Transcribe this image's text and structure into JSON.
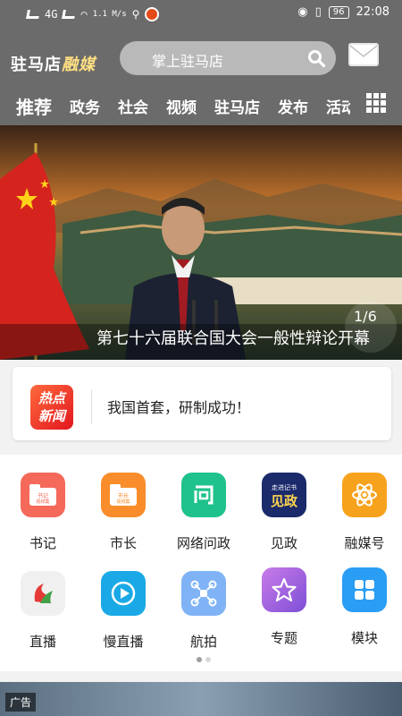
{
  "status_bar": {
    "left_net": "4G",
    "speed": "1.1 M/s",
    "battery": "96",
    "time": "22:08"
  },
  "header": {
    "logo_text": "驻马店",
    "logo_brand": "融媒",
    "search_placeholder": "掌上驻马店"
  },
  "tabs": [
    {
      "label": "推荐",
      "active": true
    },
    {
      "label": "政务"
    },
    {
      "label": "社会"
    },
    {
      "label": "视频"
    },
    {
      "label": "驻马店"
    },
    {
      "label": "发布"
    },
    {
      "label": "活动"
    }
  ],
  "banner": {
    "caption": "第七十六届联合国大会一般性辩论开幕",
    "pager": "1/6"
  },
  "hot_news": {
    "badge_line1": "热点",
    "badge_line2": "新闻",
    "headline": "我国首套，研制成功！"
  },
  "shortcuts": [
    {
      "label": "书记",
      "icon": "folder-shuji-icon",
      "color": "#f4695a"
    },
    {
      "label": "市长",
      "icon": "folder-shizhang-icon",
      "color": "#f98d2b"
    },
    {
      "label": "网络问政",
      "icon": "wen-icon",
      "color": "#1fc28c"
    },
    {
      "label": "见政",
      "icon": "jianzheng-logo-icon",
      "color": "#1b2a6b"
    },
    {
      "label": "融媒号",
      "icon": "atom-icon",
      "color": "#f7a21c"
    },
    {
      "label": "直播",
      "icon": "live-logo-icon",
      "color": "#f0f0f0"
    },
    {
      "label": "慢直播",
      "icon": "play-icon",
      "color": "#1aa9e6"
    },
    {
      "label": "航拍",
      "icon": "drone-icon",
      "color": "#7fb3f5"
    },
    {
      "label": "专题",
      "icon": "star-icon",
      "color": "#b26ae0"
    },
    {
      "label": "模块",
      "icon": "modules-icon",
      "color": "#2a9df4"
    }
  ],
  "ad": {
    "tag": "广告"
  }
}
